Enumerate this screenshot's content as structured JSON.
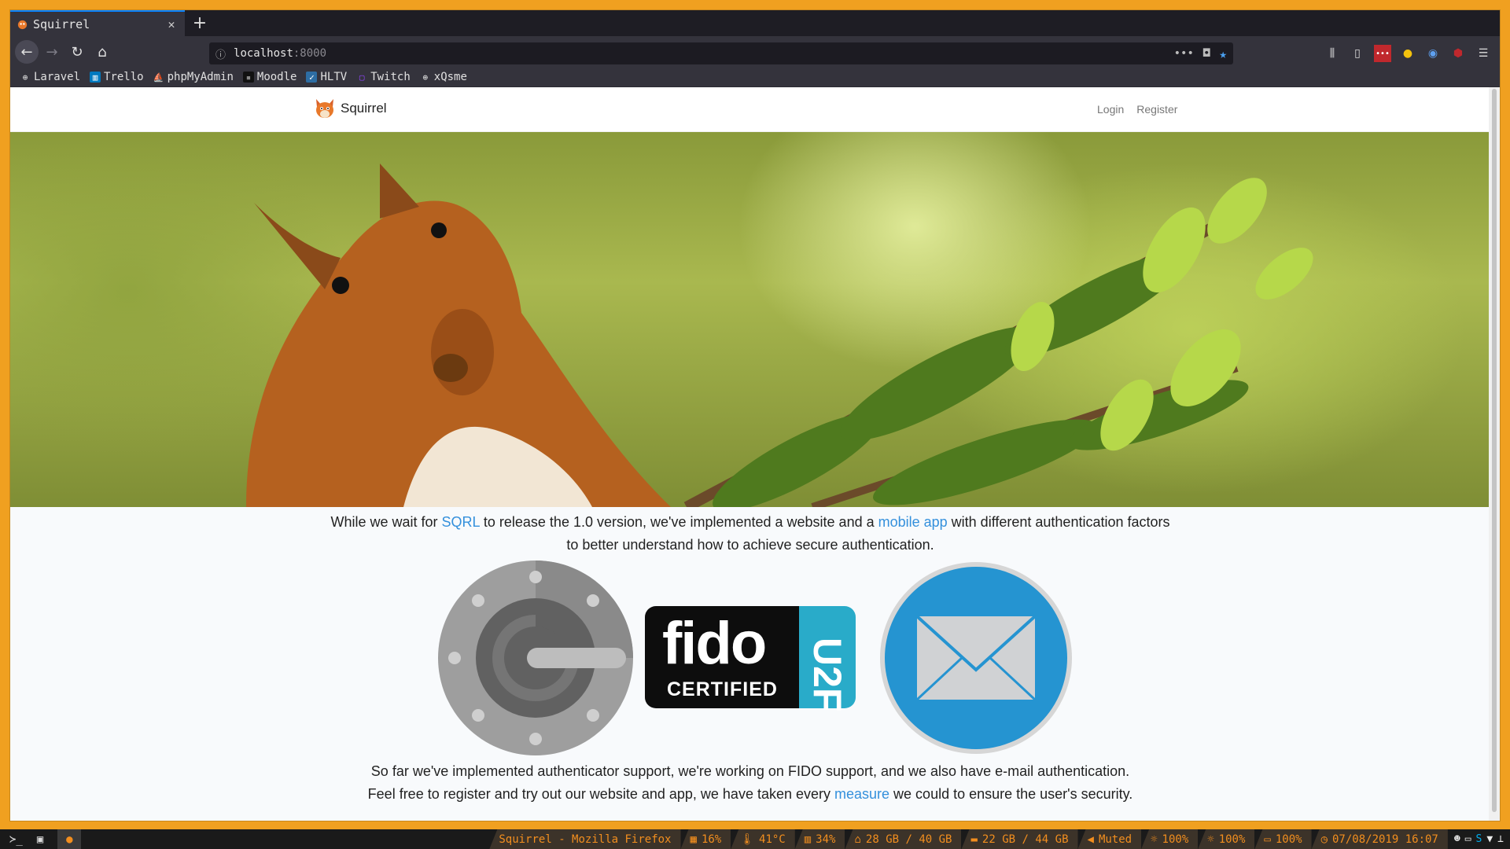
{
  "browser": {
    "tab_title": "Squirrel",
    "url_host": "localhost",
    "url_port": ":8000",
    "bookmarks": [
      "Laravel",
      "Trello",
      "phpMyAdmin",
      "Moodle",
      "HLTV",
      "Twitch",
      "xQsme"
    ]
  },
  "site": {
    "brand": "Squirrel",
    "nav": {
      "login": "Login",
      "register": "Register"
    },
    "intro": {
      "p1": "While we wait for ",
      "link_sqrl": "SQRL",
      "p2": " to release the 1.0 version, we've implemented a website and a ",
      "link_app": "mobile app",
      "p3": " with different authentication factors",
      "line2": "to better understand how to achieve secure authentication."
    },
    "fido_text": "fido",
    "fido_certified": "CERTIFIED",
    "fido_u2f": "U2F",
    "outro": {
      "line1": "So far we've implemented authenticator support, we're working on FIDO support, and we also have e-mail authentication.",
      "p1": "Feel free to register and try out our website and app, we have taken every ",
      "link_measure": "measure",
      "p2": " we could to ensure the user's security."
    }
  },
  "taskbar": {
    "window_title": "Squirrel - Mozilla Firefox",
    "cpu": "16%",
    "temp": "41°C",
    "mem": "34%",
    "home_disk": "28 GB / 40 GB",
    "root_disk": "22 GB / 44 GB",
    "volume": "Muted",
    "bright1": "100%",
    "bright2": "100%",
    "battery": "100%",
    "datetime": "07/08/2019 16:07"
  },
  "colors": {
    "accent": "#f0a020",
    "link": "#3490dc",
    "fido_blue": "#29abc9"
  }
}
